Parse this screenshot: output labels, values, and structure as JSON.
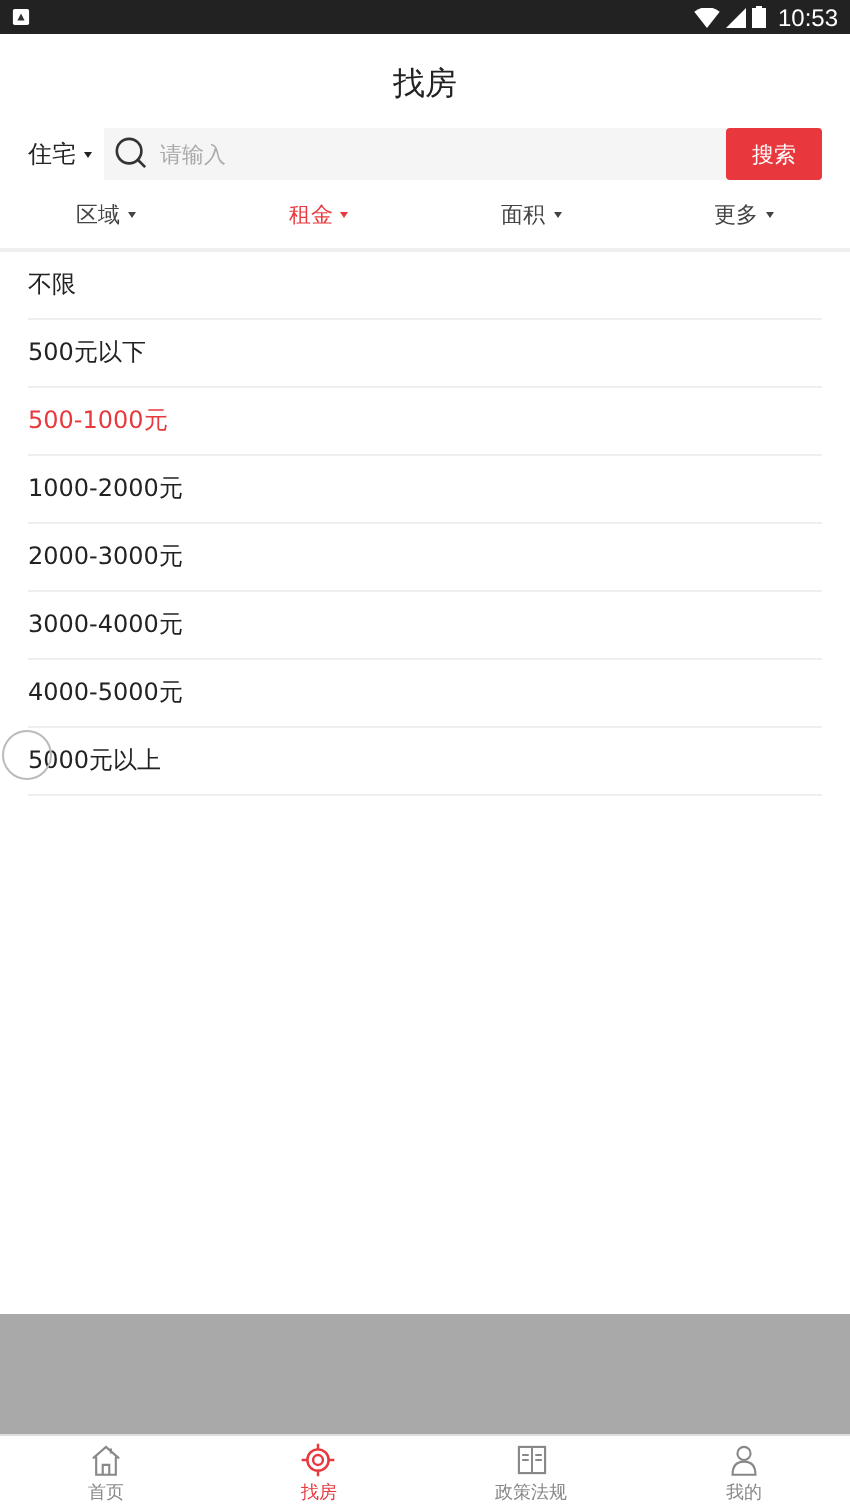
{
  "status_bar": {
    "time": "10:53"
  },
  "title": "找房",
  "search": {
    "type_label": "住宅",
    "placeholder": "请输入",
    "button": "搜索"
  },
  "filters": [
    {
      "label": "区域",
      "selected": false
    },
    {
      "label": "租金",
      "selected": true
    },
    {
      "label": "面积",
      "selected": false
    },
    {
      "label": "更多",
      "selected": false
    }
  ],
  "options": [
    {
      "label": "不限",
      "selected": false
    },
    {
      "label": "500元以下",
      "selected": false
    },
    {
      "label": "500-1000元",
      "selected": true
    },
    {
      "label": "1000-2000元",
      "selected": false
    },
    {
      "label": "2000-3000元",
      "selected": false
    },
    {
      "label": "3000-4000元",
      "selected": false
    },
    {
      "label": "4000-5000元",
      "selected": false
    },
    {
      "label": "5000元以上",
      "selected": false
    }
  ],
  "tab_bar": [
    {
      "label": "首页",
      "kind": "home",
      "selected": false
    },
    {
      "label": "找房",
      "kind": "target",
      "selected": true
    },
    {
      "label": "政策法规",
      "kind": "book",
      "selected": false
    },
    {
      "label": "我的",
      "kind": "person",
      "selected": false
    }
  ]
}
